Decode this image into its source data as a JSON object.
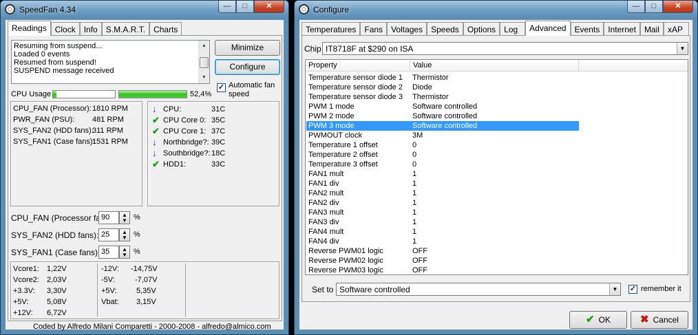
{
  "speedfan": {
    "title": "SpeedFan 4.34",
    "tabs": [
      "Readings",
      "Clock",
      "Info",
      "S.M.A.R.T.",
      "Charts"
    ],
    "log": [
      "Resuming from suspend...",
      "Loaded 0 events",
      "Resumed from suspend!",
      "SUSPEND message received"
    ],
    "buttons": {
      "minimize": "Minimize",
      "configure": "Configure"
    },
    "auto_fan": {
      "label_1": "Automatic fan",
      "label_2": "speed",
      "checked_mark": "✓"
    },
    "cpu_usage": {
      "label": "CPU Usage",
      "core1_fraction": 0.05,
      "core2_fraction": 1.0,
      "percent": "52,4%"
    },
    "fans": [
      {
        "label": "CPU_FAN (Processor):",
        "value": "1810 RPM"
      },
      {
        "label": "PWR_FAN (PSU):",
        "value": "481 RPM"
      },
      {
        "label": "SYS_FAN2 (HDD fans):",
        "value": "311 RPM"
      },
      {
        "label": "SYS_FAN1 (Case fans):",
        "value": "1531 RPM"
      }
    ],
    "temps": [
      {
        "icon": "arrow-down",
        "label": "CPU:",
        "value": "31C"
      },
      {
        "icon": "check",
        "label": "CPU Core 0:",
        "value": "35C"
      },
      {
        "icon": "check",
        "label": "CPU Core 1:",
        "value": "37C"
      },
      {
        "icon": "arrow-down",
        "label": "Northbridge?:",
        "value": "39C"
      },
      {
        "icon": "arrow-down",
        "label": "Southbridge?:",
        "value": "18C"
      },
      {
        "icon": "check",
        "label": "HDD1:",
        "value": "33C"
      }
    ],
    "speeds": [
      {
        "label": "CPU_FAN (Processor fan):",
        "value": "90",
        "unit": "%"
      },
      {
        "label": "SYS_FAN2 (HDD fans):",
        "value": "25",
        "unit": "%"
      },
      {
        "label": "SYS_FAN1 (Case fans):",
        "value": "35",
        "unit": "%"
      }
    ],
    "voltages_left": [
      {
        "label": "Vcore1:",
        "value": "1,22V"
      },
      {
        "label": "Vcore2:",
        "value": "2,03V"
      },
      {
        "label": "+3.3V:",
        "value": "3,30V"
      },
      {
        "label": "+5V:",
        "value": "5,08V"
      },
      {
        "label": "+12V:",
        "value": "6,72V"
      }
    ],
    "voltages_right": [
      {
        "label": "-12V:",
        "value": "-14,75V"
      },
      {
        "label": "-5V:",
        "value": "-7,07V"
      },
      {
        "label": "+5V:",
        "value": "5,35V"
      },
      {
        "label": "Vbat:",
        "value": "3,15V"
      }
    ],
    "footer": "Coded by Alfredo Milani Comparetti - 2000-2008 - alfredo@almico.com"
  },
  "configure": {
    "title": "Configure",
    "tabs": [
      "Temperatures",
      "Fans",
      "Voltages",
      "Speeds",
      "Options",
      "Log",
      "Advanced",
      "Events",
      "Internet",
      "Mail",
      "xAP"
    ],
    "active_tab": 6,
    "chip_label": "Chip",
    "chip_value": "IT8718F at $290 on ISA",
    "columns": [
      "Property",
      "Value"
    ],
    "rows": [
      {
        "property": "Temperature sensor diode 1",
        "value": "Thermistor"
      },
      {
        "property": "Temperature sensor diode 2",
        "value": "Diode"
      },
      {
        "property": "Temperature sensor diode 3",
        "value": "Thermistor"
      },
      {
        "property": "PWM 1 mode",
        "value": "Software controlled"
      },
      {
        "property": "PWM 2 mode",
        "value": "Software controlled"
      },
      {
        "property": "PWM 3 mode",
        "value": "Software controlled"
      },
      {
        "property": "PWMOUT clock",
        "value": "3M"
      },
      {
        "property": "Temperature 1 offset",
        "value": "0"
      },
      {
        "property": "Temperature 2 offset",
        "value": "0"
      },
      {
        "property": "Temperature 3 offset",
        "value": "0"
      },
      {
        "property": "FAN1 mult",
        "value": "1"
      },
      {
        "property": "FAN1 div",
        "value": "1"
      },
      {
        "property": "FAN2 mult",
        "value": "1"
      },
      {
        "property": "FAN2 div",
        "value": "1"
      },
      {
        "property": "FAN3 mult",
        "value": "1"
      },
      {
        "property": "FAN3 div",
        "value": "1"
      },
      {
        "property": "FAN4 mult",
        "value": "1"
      },
      {
        "property": "FAN4 div",
        "value": "1"
      },
      {
        "property": "Reverse PWM01 logic",
        "value": "OFF"
      },
      {
        "property": "Reverse PWM02 logic",
        "value": "OFF"
      },
      {
        "property": "Reverse PWM03 logic",
        "value": "OFF"
      }
    ],
    "selected_row": 5,
    "set_to_label": "Set to",
    "set_to_value": "Software controlled",
    "remember_label": "remember it",
    "remember_mark": "✓",
    "ok": "OK",
    "cancel": "Cancel"
  },
  "colors": {
    "selection": "#3399ff",
    "meter_green": "#36c11d",
    "title_blue": "#6f9fc4"
  }
}
